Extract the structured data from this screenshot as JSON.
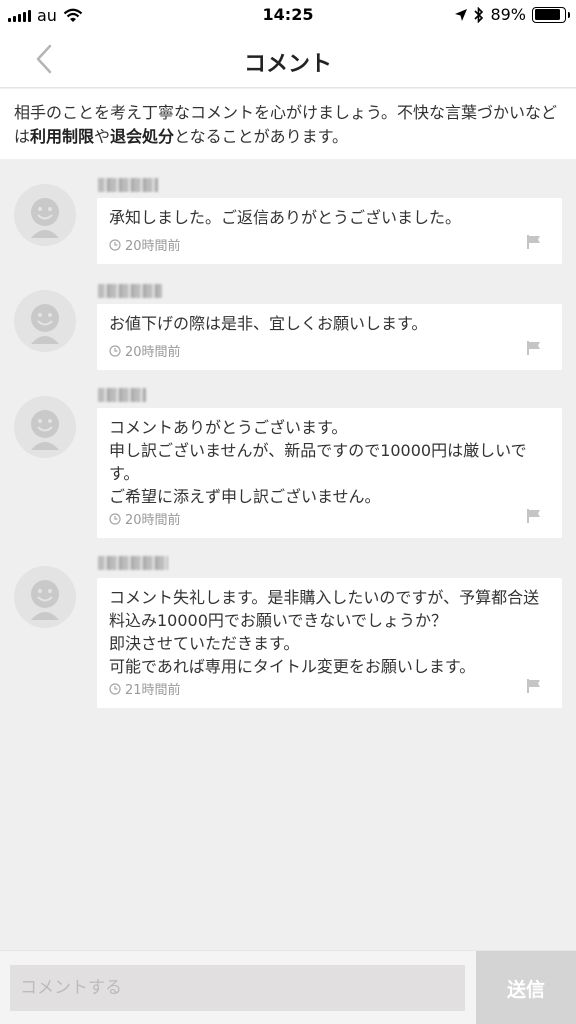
{
  "status_bar": {
    "carrier": "au",
    "time": "14:25",
    "battery_percent": "89%",
    "battery_level": 0.89,
    "icons": [
      "signal-icon",
      "wifi-icon",
      "location-icon",
      "bluetooth-icon",
      "battery-icon"
    ]
  },
  "nav": {
    "title": "コメント",
    "back_icon": "chevron-left-icon"
  },
  "notice": {
    "part1": "相手のことを考え丁寧なコメントを心がけましょう。不快な言葉づかいなどは",
    "bold1": "利用制限",
    "part2": "や",
    "bold2": "退会処分",
    "part3": "となることがあります。"
  },
  "comments": [
    {
      "text": "承知しました。ご返信ありがとうございました。",
      "time": "20時間前"
    },
    {
      "text": "お値下げの際は是非、宜しくお願いします。",
      "time": "20時間前"
    },
    {
      "text": "コメントありがとうございます。\n申し訳ございませんが、新品ですので10000円は厳しいです。\nご希望に添えず申し訳ございません。",
      "time": "20時間前"
    },
    {
      "text": "コメント失礼します。是非購入したいのですが、予算都合送料込み10000円でお願いできないでしょうか？\n即決させていただきます。\n可能であれば専用にタイトル変更をお願いします。",
      "time": "21時間前"
    }
  ],
  "footer": {
    "input_placeholder": "コメントする",
    "send_label": "送信"
  },
  "colors": {
    "background": "#efefef",
    "avatar_bg": "#e3e3e3",
    "send_button": "#d4d4d4",
    "meta_text": "#9a9a9a"
  }
}
